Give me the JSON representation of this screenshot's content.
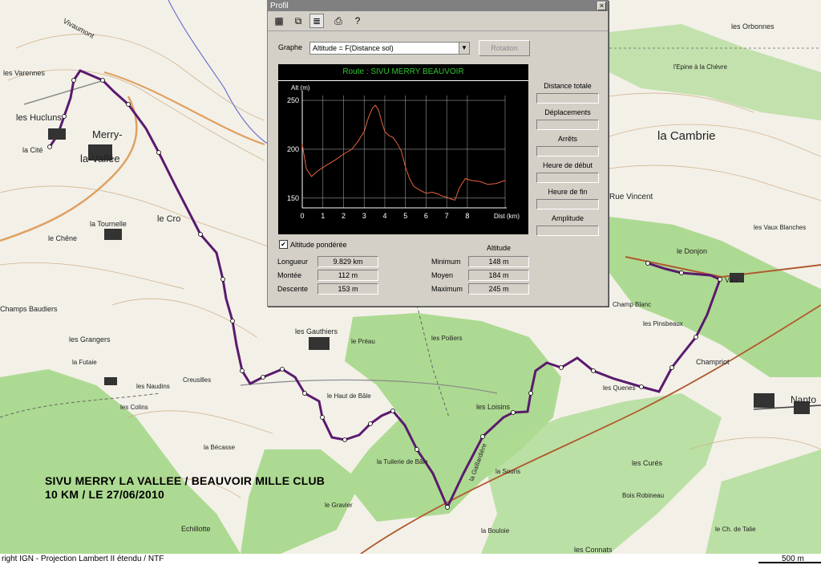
{
  "map": {
    "places": [
      {
        "name": "Vivaumont",
        "key": "vivaumont"
      },
      {
        "name": "les Varennes",
        "key": "varennes"
      },
      {
        "name": "les Hucluns",
        "key": "hucluns"
      },
      {
        "name": "la Cité",
        "key": "cite"
      },
      {
        "name": "Merry-",
        "key": "merry1"
      },
      {
        "name": "la-Vallée",
        "key": "merry2"
      },
      {
        "name": "la Tournelle",
        "key": "tournelle"
      },
      {
        "name": "le Chêne",
        "key": "chene"
      },
      {
        "name": "le Cro",
        "key": "cro"
      },
      {
        "name": "Champs Baudiers",
        "key": "baudiers"
      },
      {
        "name": "les Grangers",
        "key": "grangers"
      },
      {
        "name": "la Futaie",
        "key": "futaie"
      },
      {
        "name": "Creusilles",
        "key": "creusilles"
      },
      {
        "name": "les Naudins",
        "key": "naudins"
      },
      {
        "name": "les Colins",
        "key": "colins"
      },
      {
        "name": "les Gauthiers",
        "key": "gauthiers"
      },
      {
        "name": "le Préau",
        "key": "preau"
      },
      {
        "name": "les Poiliers",
        "key": "poiliers"
      },
      {
        "name": "le Haut de Bâle",
        "key": "hautbale"
      },
      {
        "name": "la Tuilerie de Bâle",
        "key": "tuilerie"
      },
      {
        "name": "les Loisins",
        "key": "loisins"
      },
      {
        "name": "la Souris",
        "key": "souris"
      },
      {
        "name": "la Bécasse",
        "key": "becasse"
      },
      {
        "name": "le Gravier",
        "key": "gravier"
      },
      {
        "name": "Echillotte",
        "key": "echillotte"
      },
      {
        "name": "la Bouloie",
        "key": "bouloie"
      },
      {
        "name": "les Connats",
        "key": "connats"
      },
      {
        "name": "les Curés",
        "key": "cures"
      },
      {
        "name": "Bois Robineau",
        "key": "robineau"
      },
      {
        "name": "le Ch. de Talie",
        "key": "talie"
      },
      {
        "name": "les Orbonnes",
        "key": "orbonnes"
      },
      {
        "name": "l'Epine à la Chèvre",
        "key": "epine"
      },
      {
        "name": "la Cambrie",
        "key": "cambrie"
      },
      {
        "name": "Rue Vincent",
        "key": "ruevincent"
      },
      {
        "name": "les Vaux Blanches",
        "key": "vauxblanches"
      },
      {
        "name": "le Donjon",
        "key": "donjon"
      },
      {
        "name": "Vau",
        "key": "vau"
      },
      {
        "name": "Champ Blanc",
        "key": "champblanc"
      },
      {
        "name": "les Pinsbeaux",
        "key": "pinsbeaux"
      },
      {
        "name": "Champriot",
        "key": "champriot"
      },
      {
        "name": "les Quenes",
        "key": "quenes"
      },
      {
        "name": "Nanto",
        "key": "nanto"
      },
      {
        "name": "la Gaillardière",
        "key": "gaillardiere"
      }
    ],
    "route_label": "SIVU MERRY LA VALLEE / BEAUVOIR MILLE CLUB",
    "route_date": "10 KM / LE 27/06/2010",
    "copyright": "right IGN - Projection Lambert II étendu / NTF",
    "scale_label": "500 m"
  },
  "window": {
    "title": "Profil",
    "close": "×",
    "toolbar": [
      {
        "key": "grid",
        "icon": "grid-icon"
      },
      {
        "key": "settings",
        "icon": "settings-icon"
      },
      {
        "key": "profile",
        "icon": "profile-icon"
      },
      {
        "key": "print",
        "icon": "print-icon"
      },
      {
        "key": "help",
        "icon": "help-icon"
      }
    ],
    "graphe_label": "Graphe",
    "graphe_value": "Altitude = F(Distance sol)",
    "rotation_label": "Rotation",
    "right_fields": [
      "Distance totale",
      "Déplacements",
      "Arrêts",
      "Heure de début",
      "Heure de fin",
      "Amplitude"
    ],
    "altitude_ponderee": "Altitude pondérée",
    "altitude_header": "Altitude",
    "stats_left": [
      {
        "label": "Longueur",
        "value": "9.829 km"
      },
      {
        "label": "Montée",
        "value": "112 m"
      },
      {
        "label": "Descente",
        "value": "153 m"
      }
    ],
    "stats_right": [
      {
        "label": "Minimum",
        "value": "148 m"
      },
      {
        "label": "Moyen",
        "value": "184 m"
      },
      {
        "label": "Maximum",
        "value": "245 m"
      }
    ]
  },
  "chart_data": {
    "type": "line",
    "title": "Route : SIVU MERRY BEAUVOIR",
    "xlabel": "Dist (km)",
    "ylabel": "Alt (m)",
    "xlim": [
      0,
      9.829
    ],
    "ylim": [
      140,
      255
    ],
    "xticks": [
      0,
      1,
      2,
      3,
      4,
      5,
      6,
      7,
      8
    ],
    "yticks": [
      150,
      200,
      250
    ],
    "grid": true,
    "color": "#e8633f",
    "title_color": "#2fc72f",
    "x": [
      0,
      0.2,
      0.45,
      0.7,
      0.9,
      1.2,
      1.6,
      2.0,
      2.4,
      2.7,
      3.0,
      3.2,
      3.4,
      3.55,
      3.7,
      3.85,
      4.0,
      4.2,
      4.4,
      4.6,
      4.8,
      5.0,
      5.2,
      5.4,
      5.7,
      6.0,
      6.3,
      6.6,
      6.8,
      7.0,
      7.2,
      7.4,
      7.6,
      7.9,
      8.2,
      8.6,
      9.0,
      9.4,
      9.829
    ],
    "y": [
      205,
      180,
      172,
      177,
      180,
      184,
      189,
      195,
      200,
      208,
      218,
      232,
      242,
      245,
      240,
      228,
      218,
      214,
      212,
      206,
      198,
      182,
      170,
      162,
      158,
      155,
      156,
      154,
      152,
      151,
      149,
      148,
      160,
      170,
      168,
      167,
      164,
      165,
      168
    ]
  },
  "route_color": "#5a1a6e"
}
